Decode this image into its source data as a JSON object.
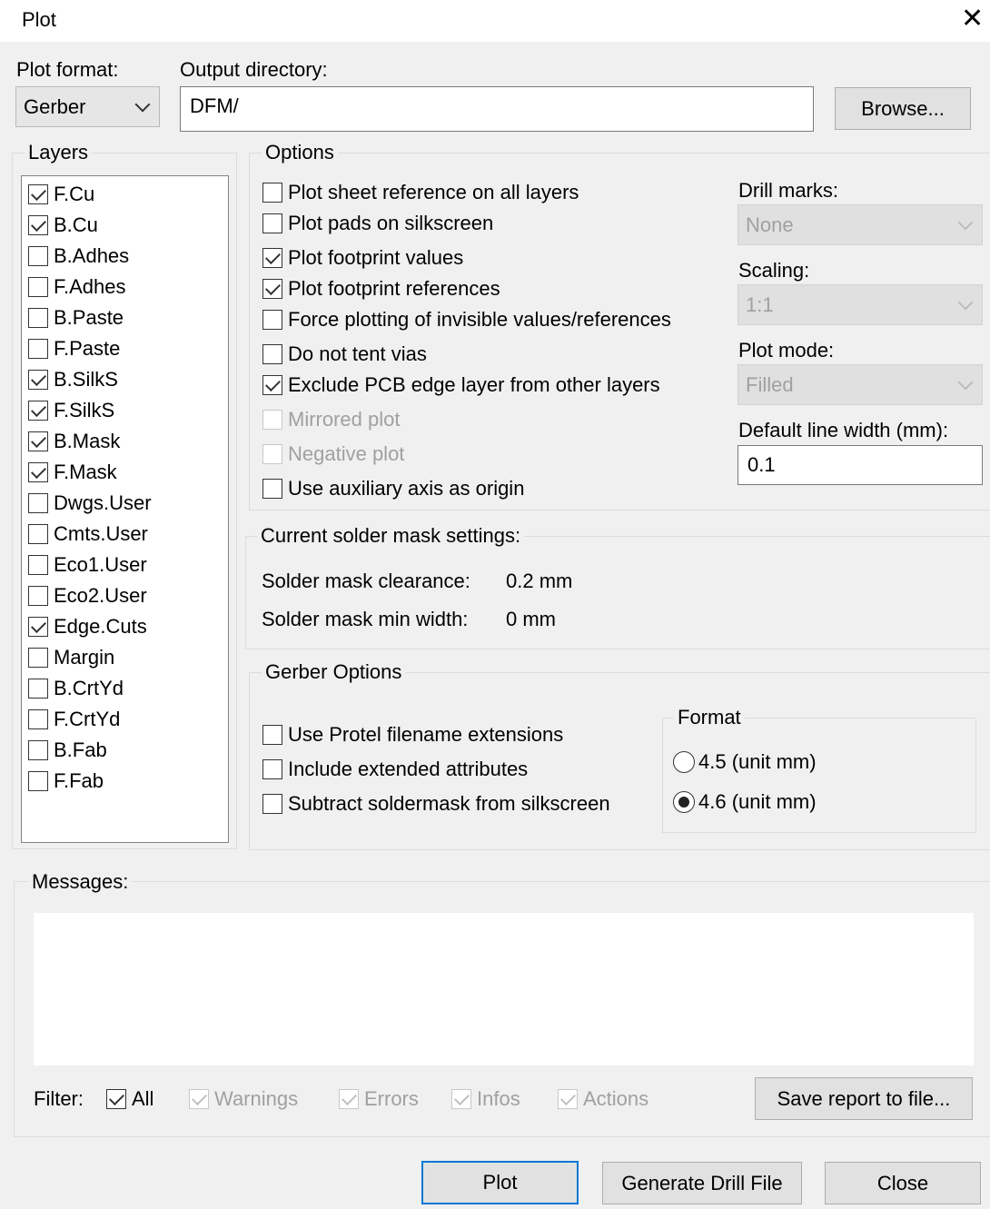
{
  "window": {
    "title": "Plot",
    "close_glyph": "✕"
  },
  "plot_format": {
    "label": "Plot format:",
    "value": "Gerber"
  },
  "output_directory": {
    "label": "Output directory:",
    "value": "DFM/",
    "browse_label": "Browse..."
  },
  "layers": {
    "title": "Layers",
    "items": [
      {
        "label": "F.Cu",
        "checked": true
      },
      {
        "label": "B.Cu",
        "checked": true
      },
      {
        "label": "B.Adhes",
        "checked": false
      },
      {
        "label": "F.Adhes",
        "checked": false
      },
      {
        "label": "B.Paste",
        "checked": false
      },
      {
        "label": "F.Paste",
        "checked": false
      },
      {
        "label": "B.SilkS",
        "checked": true
      },
      {
        "label": "F.SilkS",
        "checked": true
      },
      {
        "label": "B.Mask",
        "checked": true
      },
      {
        "label": "F.Mask",
        "checked": true
      },
      {
        "label": "Dwgs.User",
        "checked": false
      },
      {
        "label": "Cmts.User",
        "checked": false
      },
      {
        "label": "Eco1.User",
        "checked": false
      },
      {
        "label": "Eco2.User",
        "checked": false
      },
      {
        "label": "Edge.Cuts",
        "checked": true
      },
      {
        "label": "Margin",
        "checked": false
      },
      {
        "label": "B.CrtYd",
        "checked": false
      },
      {
        "label": "F.CrtYd",
        "checked": false
      },
      {
        "label": "B.Fab",
        "checked": false
      },
      {
        "label": "F.Fab",
        "checked": false
      }
    ]
  },
  "options": {
    "title": "Options",
    "items": [
      {
        "label": "Plot sheet reference on all layers",
        "checked": false,
        "disabled": false
      },
      {
        "label": "Plot pads on silkscreen",
        "checked": false,
        "disabled": false
      },
      {
        "label": "Plot footprint values",
        "checked": true,
        "disabled": false
      },
      {
        "label": "Plot footprint references",
        "checked": true,
        "disabled": false
      },
      {
        "label": "Force plotting of invisible values/references",
        "checked": false,
        "disabled": false
      },
      {
        "label": "Do not tent vias",
        "checked": false,
        "disabled": false
      },
      {
        "label": "Exclude PCB edge layer from other layers",
        "checked": true,
        "disabled": false
      },
      {
        "label": "Mirrored plot",
        "checked": false,
        "disabled": true
      },
      {
        "label": "Negative plot",
        "checked": false,
        "disabled": true
      },
      {
        "label": "Use auxiliary axis as origin",
        "checked": false,
        "disabled": false
      }
    ],
    "drill_marks": {
      "label": "Drill marks:",
      "value": "None"
    },
    "scaling": {
      "label": "Scaling:",
      "value": "1:1"
    },
    "plot_mode": {
      "label": "Plot mode:",
      "value": "Filled"
    },
    "line_width": {
      "label": "Default line width (mm):",
      "value": "0.1"
    }
  },
  "solder_mask": {
    "title": "Current solder mask settings:",
    "clearance_label": "Solder mask clearance:",
    "clearance_value": "0.2 mm",
    "min_width_label": "Solder mask min width:",
    "min_width_value": "0 mm"
  },
  "gerber": {
    "title": "Gerber Options",
    "items": [
      {
        "label": "Use Protel filename extensions",
        "checked": false
      },
      {
        "label": "Include extended attributes",
        "checked": false
      },
      {
        "label": "Subtract soldermask from silkscreen",
        "checked": false
      }
    ],
    "format": {
      "title": "Format",
      "options": [
        {
          "label": "4.5 (unit mm)",
          "selected": false
        },
        {
          "label": "4.6 (unit mm)",
          "selected": true
        }
      ]
    }
  },
  "messages": {
    "title": "Messages:",
    "filter_label": "Filter:",
    "filters": [
      {
        "label": "All",
        "checked": true,
        "disabled": false
      },
      {
        "label": "Warnings",
        "checked": true,
        "disabled": true
      },
      {
        "label": "Errors",
        "checked": true,
        "disabled": true
      },
      {
        "label": "Infos",
        "checked": true,
        "disabled": true
      },
      {
        "label": "Actions",
        "checked": true,
        "disabled": true
      }
    ],
    "save_label": "Save report to file..."
  },
  "footer": {
    "plot_label": "Plot",
    "drill_label": "Generate Drill File",
    "close_label": "Close"
  }
}
